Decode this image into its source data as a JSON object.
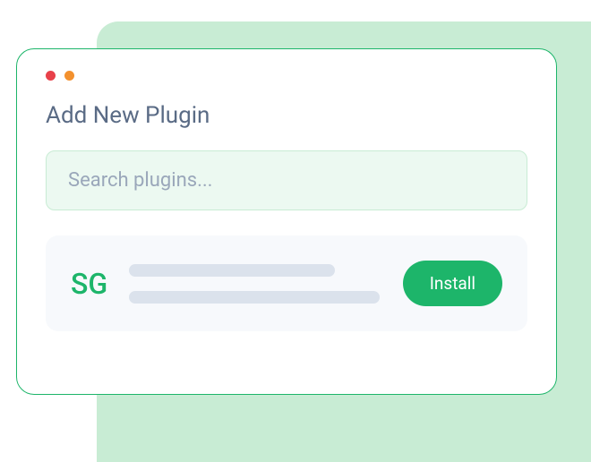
{
  "page": {
    "title": "Add New Plugin"
  },
  "search": {
    "placeholder": "Search plugins..."
  },
  "plugin": {
    "badge": "SG",
    "install_label": "Install"
  },
  "colors": {
    "accent": "#1db56a",
    "backdrop": "#c8ecd4",
    "search_bg": "#ecf9f1",
    "card_bg": "#f7f9fc",
    "text_muted": "#5a6b85",
    "skeleton": "#dbe2ec"
  }
}
